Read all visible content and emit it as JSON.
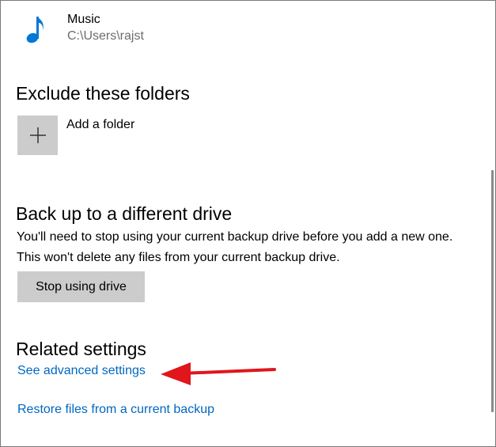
{
  "folders": {
    "music": {
      "title": "Music",
      "path": "C:\\Users\\rajst",
      "icon": "music-note-icon"
    }
  },
  "exclude": {
    "heading": "Exclude these folders",
    "add_label": "Add a folder",
    "add_icon": "plus-icon"
  },
  "different_drive": {
    "heading": "Back up to a different drive",
    "description": "You'll need to stop using your current backup drive before you add a new one. This won't delete any files from your current backup drive.",
    "stop_button": "Stop using drive"
  },
  "related": {
    "heading": "Related settings",
    "advanced_link": "See advanced settings",
    "restore_link": "Restore files from a current backup"
  },
  "colors": {
    "accent": "#0067c0",
    "music_icon": "#0078d7",
    "button_bg": "#cccccc",
    "annotation_arrow": "#e0161c"
  }
}
